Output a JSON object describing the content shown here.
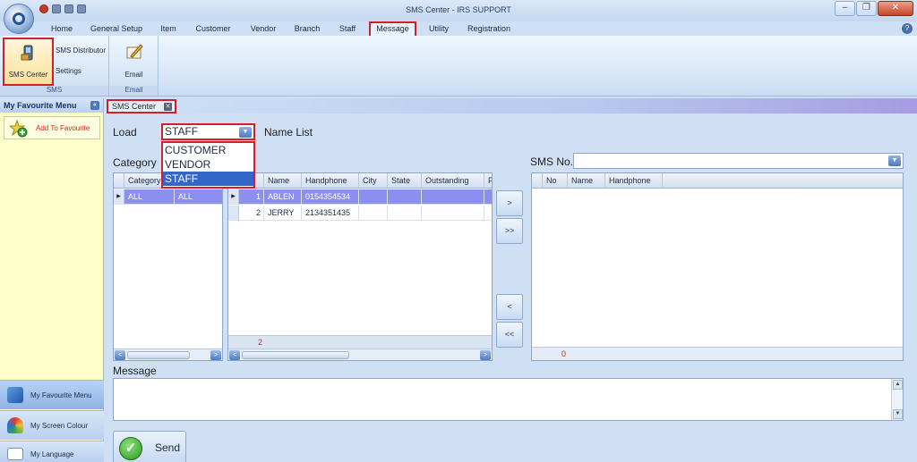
{
  "window": {
    "title": "SMS Center - IRS SUPPORT",
    "controls": {
      "minimize": "–",
      "restore": "❐",
      "close": "✕"
    }
  },
  "menu": {
    "tabs": [
      "Home",
      "General Setup",
      "Item",
      "Customer",
      "Vendor",
      "Branch",
      "Staff",
      "Message",
      "Utility",
      "Registration"
    ],
    "active": "Message",
    "help": "?"
  },
  "ribbon": {
    "sms_group": {
      "label": "SMS",
      "sms_center": "SMS Center",
      "sms_distributor": "SMS Distributor",
      "settings": "Settings"
    },
    "email_group": {
      "label": "Email",
      "email": "Email"
    }
  },
  "left_panel": {
    "header": "My Favourite Menu",
    "add_favourite": "Add To Favourite",
    "nav": [
      "My Favourite Menu",
      "My Screen Colour",
      "My Language"
    ]
  },
  "doc_tab": {
    "label": "SMS Center",
    "close": "✕"
  },
  "form": {
    "load_label": "Load",
    "load_value": "STAFF",
    "load_options": [
      "CUSTOMER",
      "VENDOR",
      "STAFF"
    ],
    "load_selected": "STAFF",
    "name_list_label": "Name List",
    "category_label": "Category",
    "sms_no_label": "SMS No.",
    "message_label": "Message",
    "send_label": "Send"
  },
  "category_grid": {
    "columns": [
      "Category",
      ""
    ],
    "rows": [
      [
        "ALL",
        "ALL"
      ]
    ]
  },
  "name_grid": {
    "columns": [
      "",
      "Name",
      "Handphone",
      "City",
      "State",
      "Outstanding",
      "P"
    ],
    "rows": [
      [
        "1",
        "ABLEN",
        "0154354534",
        "",
        "",
        "",
        ""
      ],
      [
        "2",
        "JERRY",
        "2134351435",
        "",
        "",
        "",
        ""
      ]
    ],
    "footer_count": "2"
  },
  "move_buttons": [
    ">",
    ">>",
    "<",
    "<<"
  ],
  "sms_grid": {
    "columns": [
      "No",
      "Name",
      "Handphone"
    ],
    "footer_count": "0"
  },
  "scroll": {
    "left": "<",
    "right": ">",
    "up": "▲",
    "down": "▼",
    "grip": "III"
  },
  "colors": {
    "highlight_red": "#d31e2c",
    "selected_row": "#8d8ff0",
    "dropdown_selected": "#3466c9",
    "favourite_bg": "#fefec8"
  }
}
